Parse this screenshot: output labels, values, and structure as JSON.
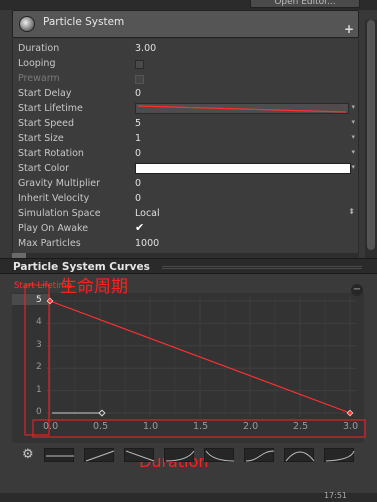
{
  "top": {
    "open_editor_label": "Open Editor..."
  },
  "module": {
    "title": "Particle System",
    "plus": "+"
  },
  "properties": [
    {
      "label": "Duration",
      "value": "3.00",
      "kind": "number"
    },
    {
      "label": "Looping",
      "value": "",
      "kind": "checkbox",
      "checked": false
    },
    {
      "label": "Prewarm",
      "value": "",
      "kind": "checkbox-disabled",
      "checked": false
    },
    {
      "label": "Start Delay",
      "value": "0",
      "kind": "number"
    },
    {
      "label": "Start Lifetime",
      "value": "",
      "kind": "curve"
    },
    {
      "label": "Start Speed",
      "value": "5",
      "kind": "number-dropdown"
    },
    {
      "label": "Start Size",
      "value": "1",
      "kind": "number-dropdown"
    },
    {
      "label": "Start Rotation",
      "value": "0",
      "kind": "number-dropdown"
    },
    {
      "label": "Start Color",
      "value": "",
      "kind": "color"
    },
    {
      "label": "Gravity Multiplier",
      "value": "0",
      "kind": "number"
    },
    {
      "label": "Inherit Velocity",
      "value": "0",
      "kind": "number"
    },
    {
      "label": "Simulation Space",
      "value": "Local",
      "kind": "select"
    },
    {
      "label": "Play On Awake",
      "value": "",
      "kind": "checkbox",
      "checked": true
    },
    {
      "label": "Max Particles",
      "value": "1000",
      "kind": "number"
    }
  ],
  "curves": {
    "header_title": "Particle System Curves",
    "curve_name": "Start Lifetime",
    "minus": "−",
    "annotation_cn": "生命周期",
    "annotation_duration": "Duration",
    "y_ticks": [
      "5",
      "4",
      "3",
      "2",
      "1",
      "0"
    ],
    "x_ticks": [
      "0.0",
      "0.5",
      "1.0",
      "1.5",
      "2.0",
      "2.5",
      "3.0"
    ],
    "chart_data": {
      "type": "line",
      "series": [
        {
          "name": "Start Lifetime",
          "x": [
            0,
            3.0
          ],
          "y": [
            5,
            0
          ]
        }
      ],
      "xlim": [
        0,
        3.0
      ],
      "ylim": [
        0,
        5
      ]
    },
    "presets": [
      "flat",
      "linear-up",
      "linear-down",
      "ease-in",
      "ease-out",
      "ease-in-out",
      "bell",
      "step"
    ],
    "colors": {
      "curve": "#ff3030",
      "annotation": "#ff2020",
      "background": "#3a3a3a"
    }
  },
  "status": {
    "time": "17:51"
  }
}
